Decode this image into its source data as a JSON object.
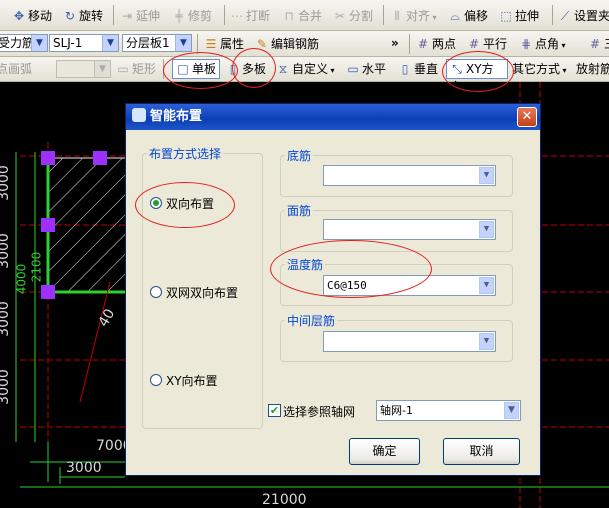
{
  "toolbar1": {
    "move": "移动",
    "rotate": "旋转",
    "extend": "延伸",
    "trim": "修剪",
    "break": "打断",
    "merge": "合并",
    "split": "分割",
    "align": "对齐",
    "offset": "偏移",
    "stretch": "拉伸",
    "set_slope": "设置夹"
  },
  "toolbar2": {
    "category_value": "受力筋",
    "name_value": "SLJ-1",
    "layer_value": "分层板1",
    "properties": "属性",
    "edit_rebar": "编辑钢筋",
    "two_points": "两点",
    "parallel": "平行",
    "point_angle": "点角",
    "three_points": "三"
  },
  "toolbar3": {
    "point_arc": "点画弧",
    "rectangle": "矩形",
    "single_slab": "单板",
    "multi_slab": "多板",
    "custom": "自定义",
    "horizontal": "水平",
    "vertical": "垂直",
    "xy_direction": "XY方向",
    "other_methods": "其它方式",
    "radial": "放射筋"
  },
  "canvas": {
    "dims_left": [
      "3000",
      "3000",
      "3000",
      "3000"
    ],
    "dim_overlap": "4000",
    "dim_2100": "2100",
    "dim_7000": "7000",
    "dim_3000_bottom": "3000",
    "dim_21000": "21000",
    "angle_label": "40",
    "left_b1": "4000",
    "left_b2": "2100"
  },
  "dialog": {
    "title": "智能布置",
    "close": "✕",
    "method_group": "布置方式选择",
    "opt_bidirectional": "双向布置",
    "opt_double_mesh": "双网双向布置",
    "opt_xy": "XY向布置",
    "bottom_rebar": "底筋",
    "top_rebar": "面筋",
    "temp_rebar": "温度筋",
    "temp_rebar_value": "C6@150",
    "middle_rebar": "中间层筋",
    "ref_axis_label": "选择参照轴网",
    "axis_value": "轴网-1",
    "ok": "确定",
    "cancel": "取消"
  },
  "colors": {
    "dialog_title_bg": "#0a3fb5",
    "annotation_red": "#e02020",
    "grid_red": "#c00000",
    "slab_green": "#2ecf2e",
    "grip_purple": "#9b30ff"
  }
}
